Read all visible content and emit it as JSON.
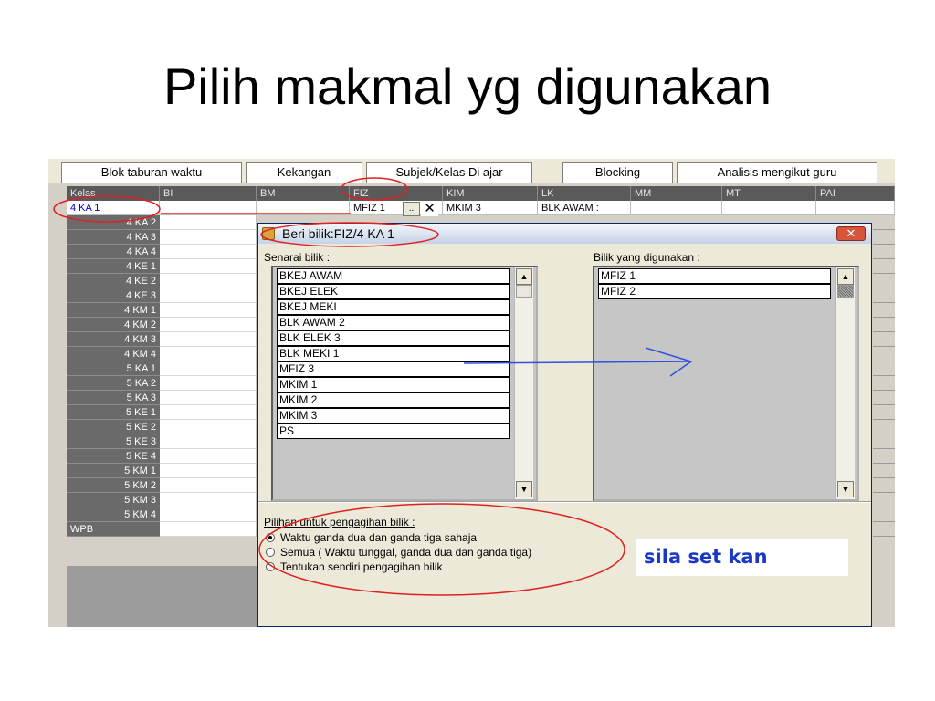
{
  "slide": {
    "title": "Pilih makmal yg digunakan"
  },
  "tabs": [
    "Blok taburan waktu",
    "Kekangan",
    "Subjek/Kelas Di ajar",
    "Blocking",
    "Analisis mengikut guru"
  ],
  "grid": {
    "headers": [
      "Kelas",
      "BI",
      "BM",
      "FIZ",
      "KIM",
      "LK",
      "MM",
      "MT",
      "PAI"
    ],
    "first_row": {
      "kelas": "4 KA 1",
      "fiz": "MFIZ 1",
      "pick": "..",
      "delete": "✕",
      "kim": "MKIM 3",
      "lk": "BLK AWAM :"
    },
    "rows": [
      "4 KA 2",
      "4 KA 3",
      "4 KA 4",
      "4 KE 1",
      "4 KE 2",
      "4 KE 3",
      "4 KM 1",
      "4 KM 2",
      "4 KM 3",
      "4 KM 4",
      "5 KA 1",
      "5 KA 2",
      "5 KA 3",
      "5 KE 1",
      "5 KE 2",
      "5 KE 3",
      "5 KE 4",
      "5 KM 1",
      "5 KM 2",
      "5 KM 3",
      "5 KM 4",
      "WPB"
    ]
  },
  "dialog": {
    "title": "Beri bilik:FIZ/4 KA 1",
    "close": "✕",
    "left_label": "Senarai bilik :",
    "right_label": "Bilik yang digunakan :",
    "available_rooms": [
      "BKEJ AWAM",
      "BKEJ ELEK",
      "BKEJ MEKI",
      "BLK AWAM 2",
      "BLK ELEK 3",
      "BLK MEKI 1",
      "MFIZ 3",
      "MKIM 1",
      "MKIM 2",
      "MKIM 3",
      "PS"
    ],
    "used_rooms": [
      "MFIZ 1",
      "MFIZ 2"
    ],
    "options_label": "Pilihan untuk pengagihan bilik :",
    "options": [
      {
        "label": "Waktu ganda dua dan ganda tiga sahaja",
        "selected": true
      },
      {
        "label": "Semua ( Waktu tunggal, ganda dua dan ganda tiga)",
        "selected": false
      },
      {
        "label": "Tentukan sendiri pengagihan bilik",
        "selected": false
      }
    ],
    "callout": "sila set kan"
  },
  "icons": {
    "scroll_up": "▲",
    "scroll_down": "▼"
  },
  "colors": {
    "annotation_red": "#e02020",
    "annotation_blue": "#3050e0",
    "callout_blue": "#1a37c8"
  }
}
